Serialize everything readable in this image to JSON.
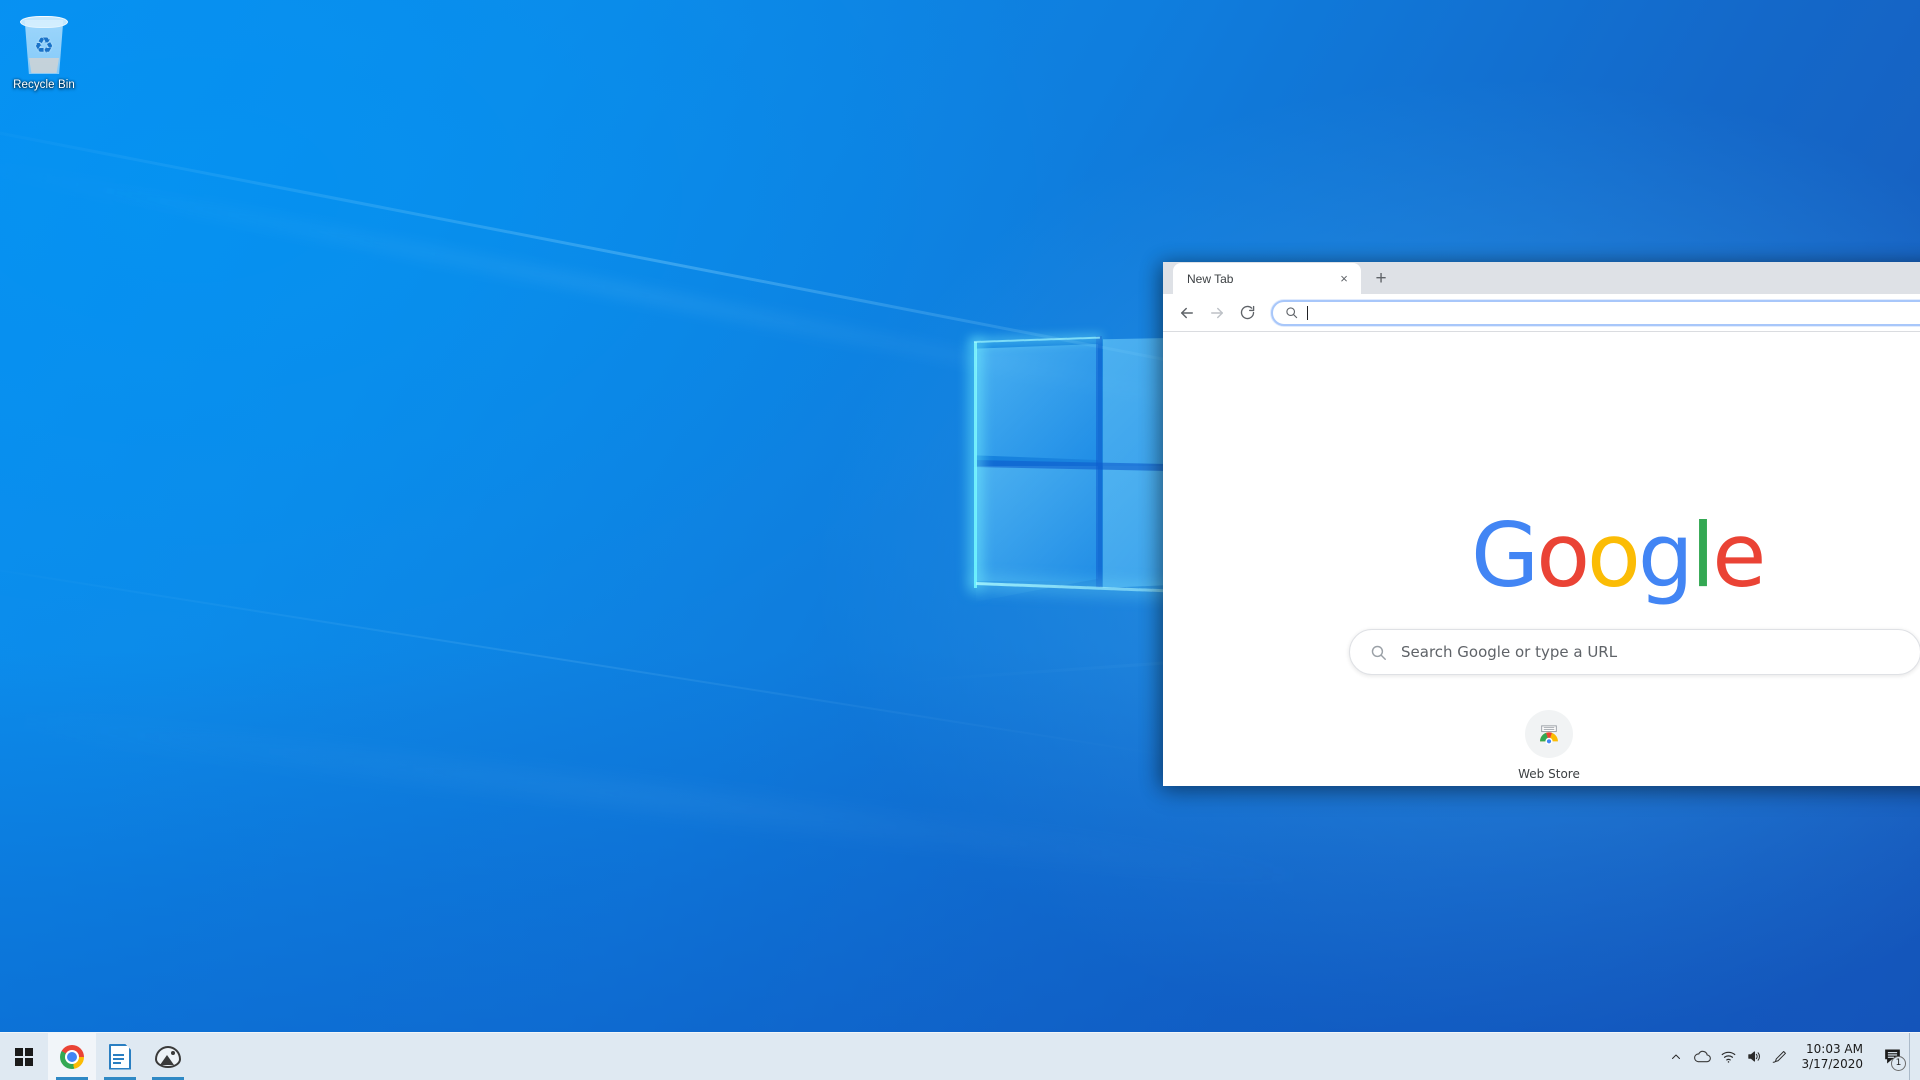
{
  "desktop": {
    "icons": [
      {
        "name": "Recycle Bin",
        "icon": "recycle-bin-icon"
      }
    ],
    "wallpaper_colors": {
      "base": "#0b78d8",
      "highlight": "#46beff",
      "deep": "#1a56b6",
      "logo_glow": "#8cfaff"
    }
  },
  "browser": {
    "tabs": [
      {
        "title": "New Tab",
        "close_label": "×",
        "active": true
      }
    ],
    "new_tab_button": "+",
    "toolbar": {
      "back_label": "Back",
      "forward_label": "Forward",
      "reload_label": "Reload",
      "omnibox_value": "",
      "omnibox_placeholder": ""
    },
    "new_tab_page": {
      "logo_letters": [
        "G",
        "o",
        "o",
        "g",
        "l",
        "e"
      ],
      "logo_colors": [
        "#4285F4",
        "#EA4335",
        "#FBBC05",
        "#4285F4",
        "#34A853",
        "#EA4335"
      ],
      "search_placeholder": "Search Google or type a URL",
      "shortcuts": [
        {
          "name": "Web Store",
          "icon": "chrome-web-store-icon"
        }
      ]
    }
  },
  "taskbar": {
    "start_label": "Start",
    "items": [
      {
        "name": "Google Chrome",
        "icon": "chrome-icon",
        "active": true,
        "running": true
      },
      {
        "name": "LibreOffice Writer",
        "icon": "writer-document-icon",
        "active": false,
        "running": true
      },
      {
        "name": "Photos",
        "icon": "photos-icon",
        "active": false,
        "running": true
      }
    ],
    "tray": [
      {
        "name": "Show hidden icons",
        "icon": "chevron-up-icon"
      },
      {
        "name": "OneDrive",
        "icon": "cloud-icon"
      },
      {
        "name": "Network",
        "icon": "wifi-icon"
      },
      {
        "name": "Volume",
        "icon": "speaker-icon"
      },
      {
        "name": "Windows Ink Workspace",
        "icon": "pen-icon"
      }
    ],
    "clock": {
      "time": "10:03 AM",
      "date": "3/17/2020"
    },
    "notifications": {
      "icon": "notification-bubble-icon",
      "count": "1"
    }
  }
}
